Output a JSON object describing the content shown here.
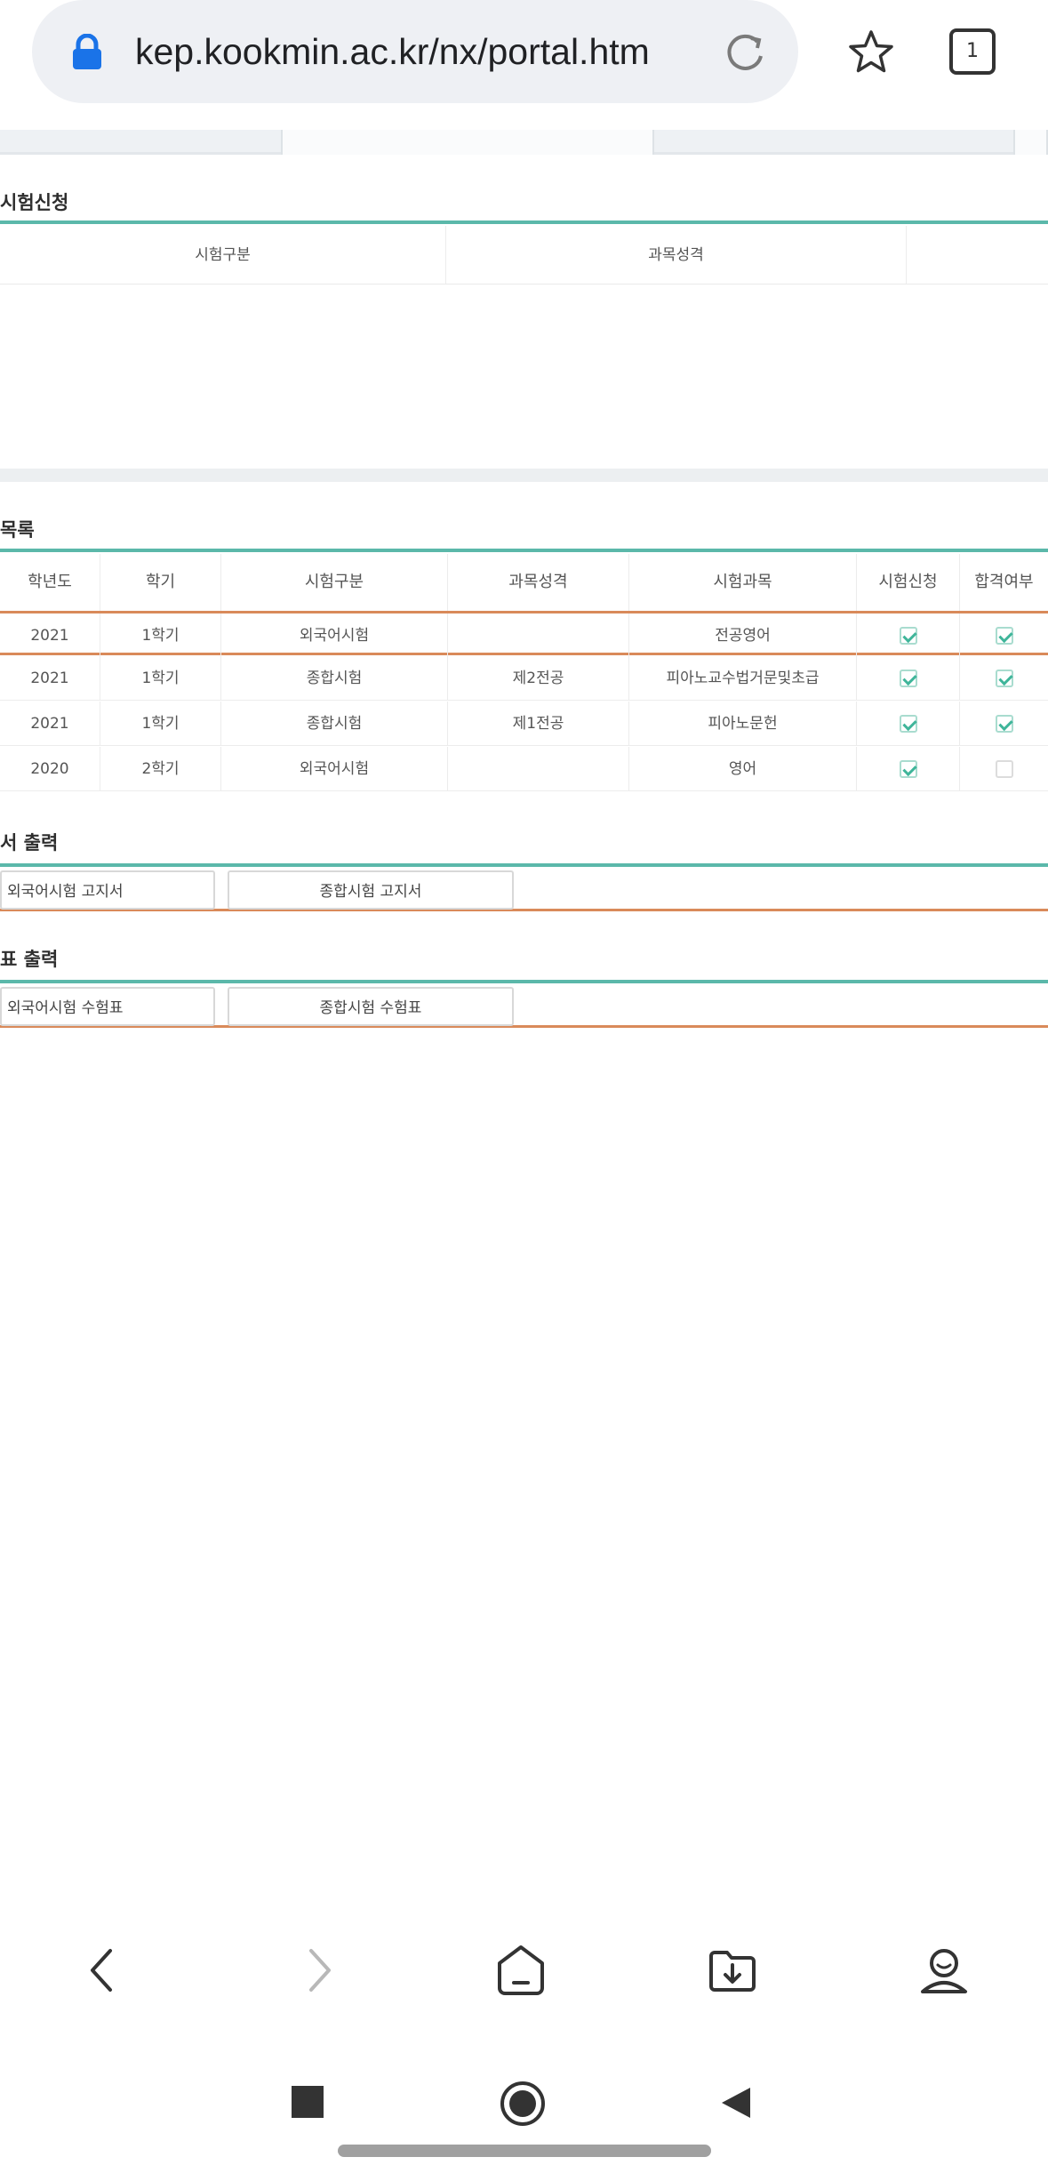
{
  "browser": {
    "url": "kep.kookmin.ac.kr/nx/portal.htm",
    "tab_count": "1"
  },
  "application_section": {
    "title": "시험신청",
    "headers": [
      "시험구분",
      "과목성격"
    ]
  },
  "list_section": {
    "title": "목록",
    "headers": [
      "학년도",
      "학기",
      "시험구분",
      "과목성격",
      "시험과목",
      "시험신청",
      "합격여부"
    ],
    "rows": [
      {
        "year": "2021",
        "term": "1학기",
        "type": "외국어시험",
        "nature": "",
        "subject": "전공영어",
        "applied": true,
        "passed": true
      },
      {
        "year": "2021",
        "term": "1학기",
        "type": "종합시험",
        "nature": "제2전공",
        "subject": "피아노교수법거문및초급",
        "applied": true,
        "passed": true
      },
      {
        "year": "2021",
        "term": "1학기",
        "type": "종합시험",
        "nature": "제1전공",
        "subject": "피아노문헌",
        "applied": true,
        "passed": true
      },
      {
        "year": "2020",
        "term": "2학기",
        "type": "외국어시험",
        "nature": "",
        "subject": "영어",
        "applied": true,
        "passed": false
      }
    ]
  },
  "notice_section": {
    "title": "서 출력",
    "buttons": [
      "외국어시험 고지서",
      "종합시험 고지서"
    ]
  },
  "ticket_section": {
    "title": "표 출력",
    "buttons": [
      "외국어시험 수험표",
      "종합시험 수험표"
    ]
  },
  "icons": {
    "lock": "lock-icon",
    "reload": "reload-icon",
    "star": "star-icon",
    "back": "back-arrow-icon",
    "forward": "forward-arrow-icon",
    "home": "home-icon",
    "downloads": "download-folder-icon",
    "profile": "profile-icon"
  },
  "colors": {
    "accent_teal": "#5bb8aa",
    "accent_orange": "#d98a5a",
    "lock_blue": "#1a73e8"
  }
}
